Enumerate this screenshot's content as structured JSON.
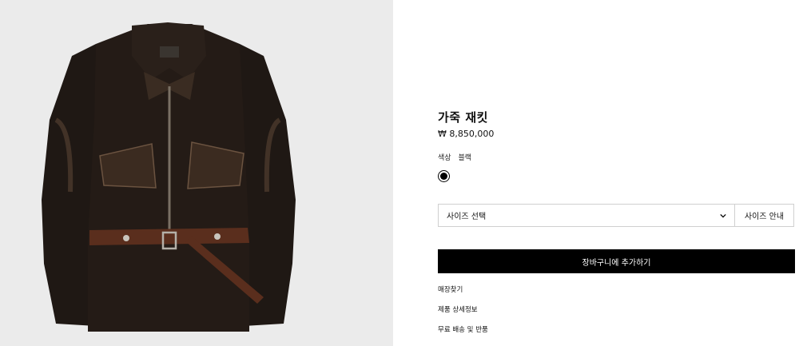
{
  "product": {
    "image_alt": "leather jacket",
    "title": "가죽 재킷",
    "price": "₩ 8,850,000",
    "color_label": "색상",
    "color_value": "블랙",
    "swatch_color": "#000000"
  },
  "size": {
    "select_label": "사이즈 선택",
    "guide_label": "사이즈 안내"
  },
  "cart": {
    "add_label": "장바구니에 추가하기"
  },
  "links": [
    {
      "label": "매장찾기"
    },
    {
      "label": "제품 상세정보"
    },
    {
      "label": "무료 배송 및 반품"
    }
  ],
  "colors": {
    "image_background": "#ebebeb",
    "jacket": "#1c1612",
    "belt": "#5a2e1d",
    "button": "#000000"
  },
  "icons": {
    "dropdown": "chevron-down-icon"
  }
}
